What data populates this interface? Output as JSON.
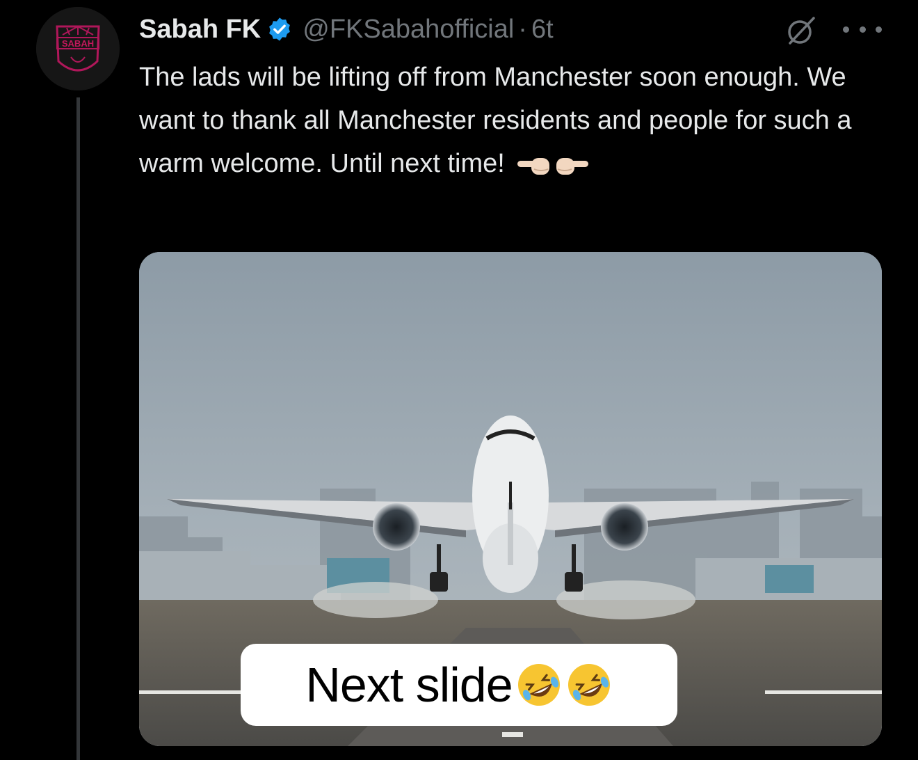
{
  "tweet": {
    "avatar_text": "SABAH",
    "display_name": "Sabah FK",
    "verified_icon": "verified-badge-icon",
    "handle": "@FKSabahofficial",
    "separator": "·",
    "time": "6t",
    "text": "The lads will be lifting off from Manchester soon enough. We want to thank all Manchester residents and people for such a warm welcome. Until next time!",
    "emojis": [
      "backhand-index-pointing-left-icon",
      "backhand-index-pointing-right-icon"
    ],
    "actions": {
      "grok_icon": "grok-icon",
      "more_icon": "more-options-icon"
    },
    "media": {
      "subject": "airplane-takeoff-photo"
    }
  },
  "overlay": {
    "caption": "Next slide",
    "caption_emojis": [
      "rolling-on-floor-laughing-icon",
      "rolling-on-floor-laughing-icon"
    ]
  },
  "colors": {
    "background": "#000000",
    "text_primary": "#e7e9ea",
    "text_secondary": "#71767b",
    "verified": "#1d9bf0",
    "avatar_accent": "#c2185b",
    "caption_bg": "#ffffff"
  }
}
